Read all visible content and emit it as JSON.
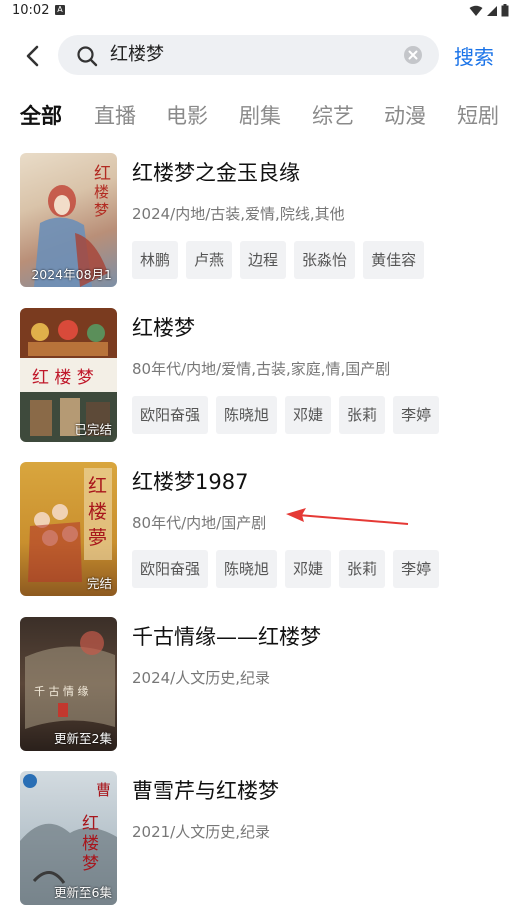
{
  "status": {
    "time": "10:02",
    "notif_icon": "A"
  },
  "search": {
    "query": "红楼梦",
    "button_label": "搜索"
  },
  "tabs": [
    "全部",
    "直播",
    "电影",
    "剧集",
    "综艺",
    "动漫",
    "短剧"
  ],
  "colors": {
    "accent": "#1a73e8",
    "annotation": "#e53935"
  },
  "results": [
    {
      "title": "红楼梦之金玉良缘",
      "meta": "2024/内地/古装,爱情,院线,其他",
      "badge": "2024年08月1",
      "tags": [
        "林鹏",
        "卢燕",
        "边程",
        "张淼怡",
        "黄佳容"
      ]
    },
    {
      "title": "红楼梦",
      "meta": "80年代/内地/爱情,古装,家庭,情,国产剧",
      "badge": "已完结",
      "tags": [
        "欧阳奋强",
        "陈晓旭",
        "邓婕",
        "张莉",
        "李婷"
      ]
    },
    {
      "title": "红楼梦1987",
      "meta": "80年代/内地/国产剧",
      "badge": "完结",
      "tags": [
        "欧阳奋强",
        "陈晓旭",
        "邓婕",
        "张莉",
        "李婷"
      ]
    },
    {
      "title": "千古情缘——红楼梦",
      "meta": "2024/人文历史,纪录",
      "badge": "更新至2集",
      "tags": []
    },
    {
      "title": "曹雪芹与红楼梦",
      "meta": "2021/人文历史,纪录",
      "badge": "更新至6集",
      "tags": []
    }
  ]
}
